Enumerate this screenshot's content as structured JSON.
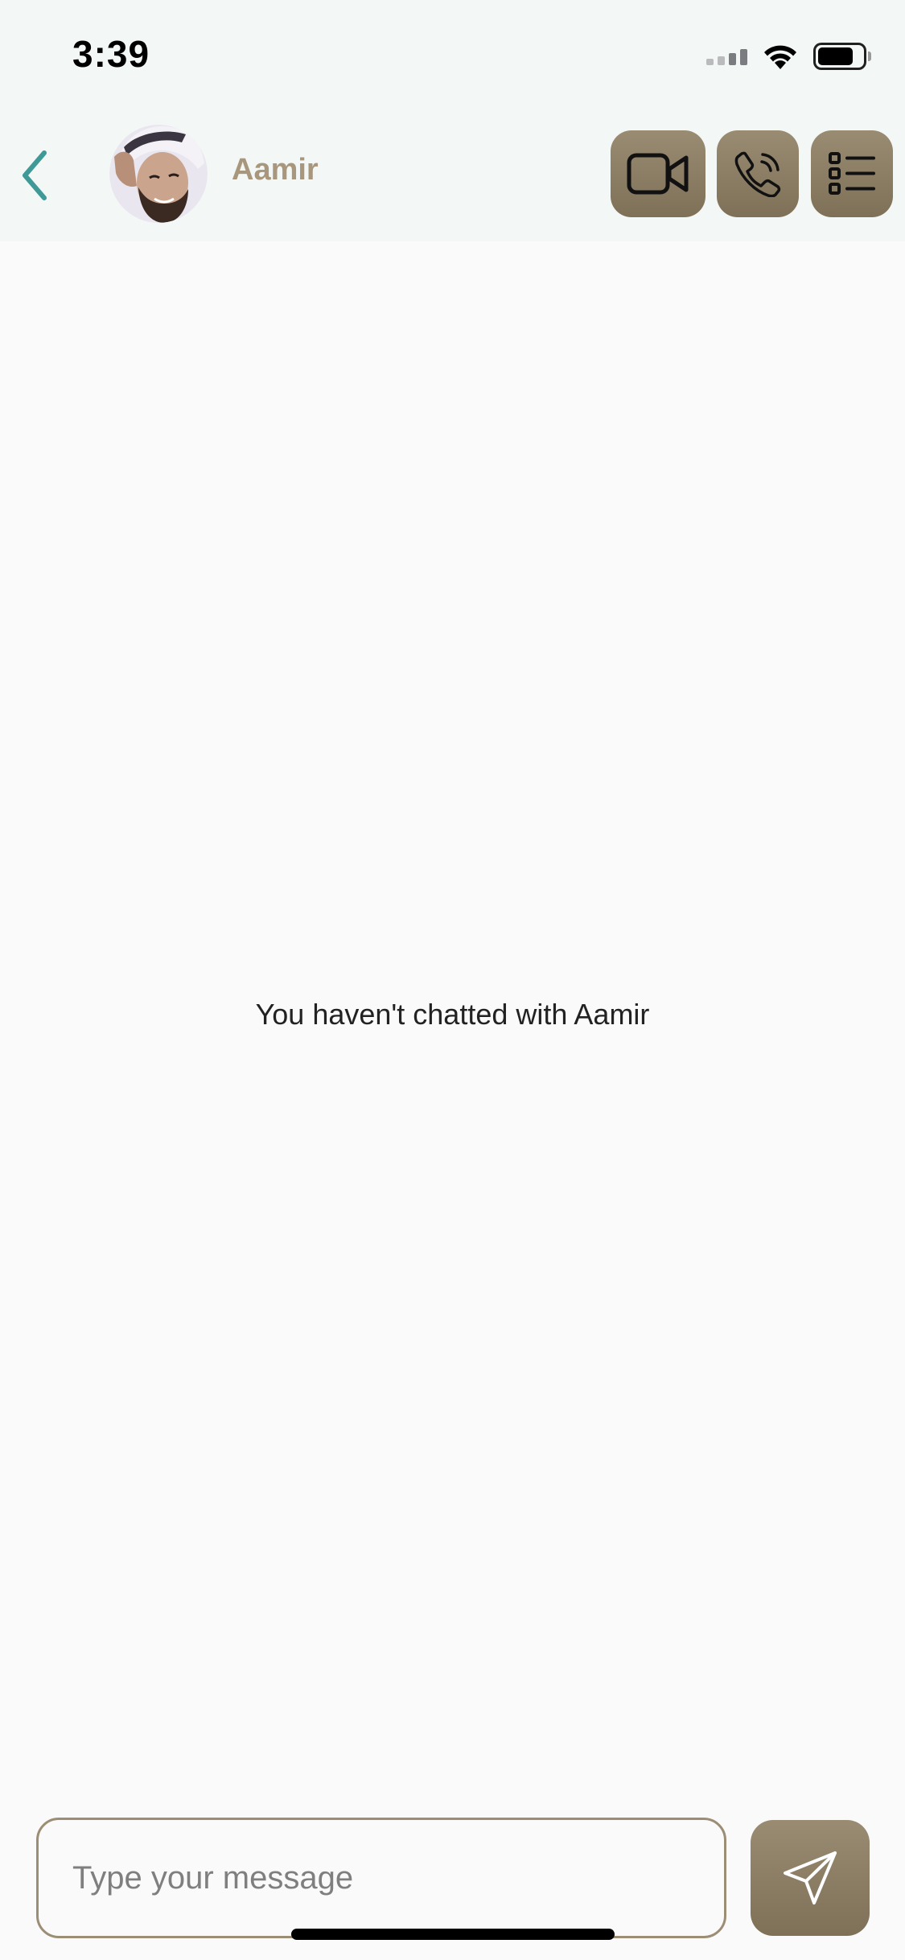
{
  "status_bar": {
    "time": "3:39",
    "icons": [
      "cellular-signal-icon",
      "wifi-icon",
      "battery-icon"
    ]
  },
  "header": {
    "back_icon": "chevron-left-icon",
    "contact_name": "Aamir",
    "avatar": "contact-avatar",
    "actions": [
      "video-camera-icon",
      "phone-icon",
      "list-icon"
    ]
  },
  "chat": {
    "empty_text": "You haven't chatted with Aamir"
  },
  "composer": {
    "placeholder": "Type your message",
    "value": "",
    "send_icon": "send-icon"
  },
  "colors": {
    "accent": "#8c7d65",
    "name": "#a8977c",
    "back_arrow": "#3f9a97",
    "header_bg": "#f3f7f5",
    "body_bg": "#fafafa"
  }
}
